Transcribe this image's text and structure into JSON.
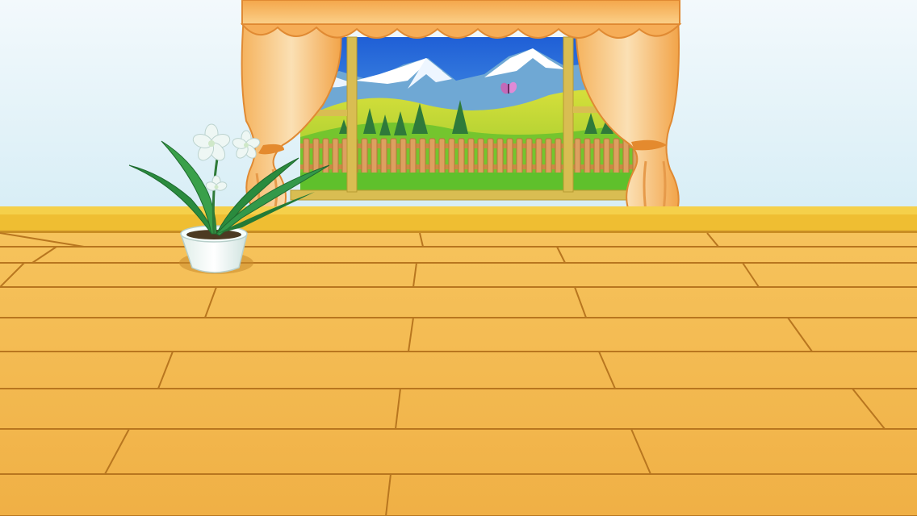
{
  "scene": {
    "name": "room-background",
    "colors": {
      "wall_top": "#f2f9fc",
      "wall_bottom": "#d7eef6",
      "baseboard": "#f2c52e",
      "floor_light": "#f7c45e",
      "floor_dark": "#eaa73a",
      "floor_seam": "#b8761f",
      "curtain": "#f6b766",
      "curtain_shadow": "#e48a2e",
      "window_frame": "#d7b84a",
      "sky": "#1f64d8",
      "grass": "#64c72c",
      "fence": "#d6924a",
      "leaf": "#2f8c3a",
      "flower": "#eef7f4",
      "pot": "#f2fbf8"
    },
    "objects": [
      "window",
      "curtains",
      "mountains",
      "fence",
      "butterfly",
      "potted-plant",
      "wooden-floor"
    ]
  }
}
